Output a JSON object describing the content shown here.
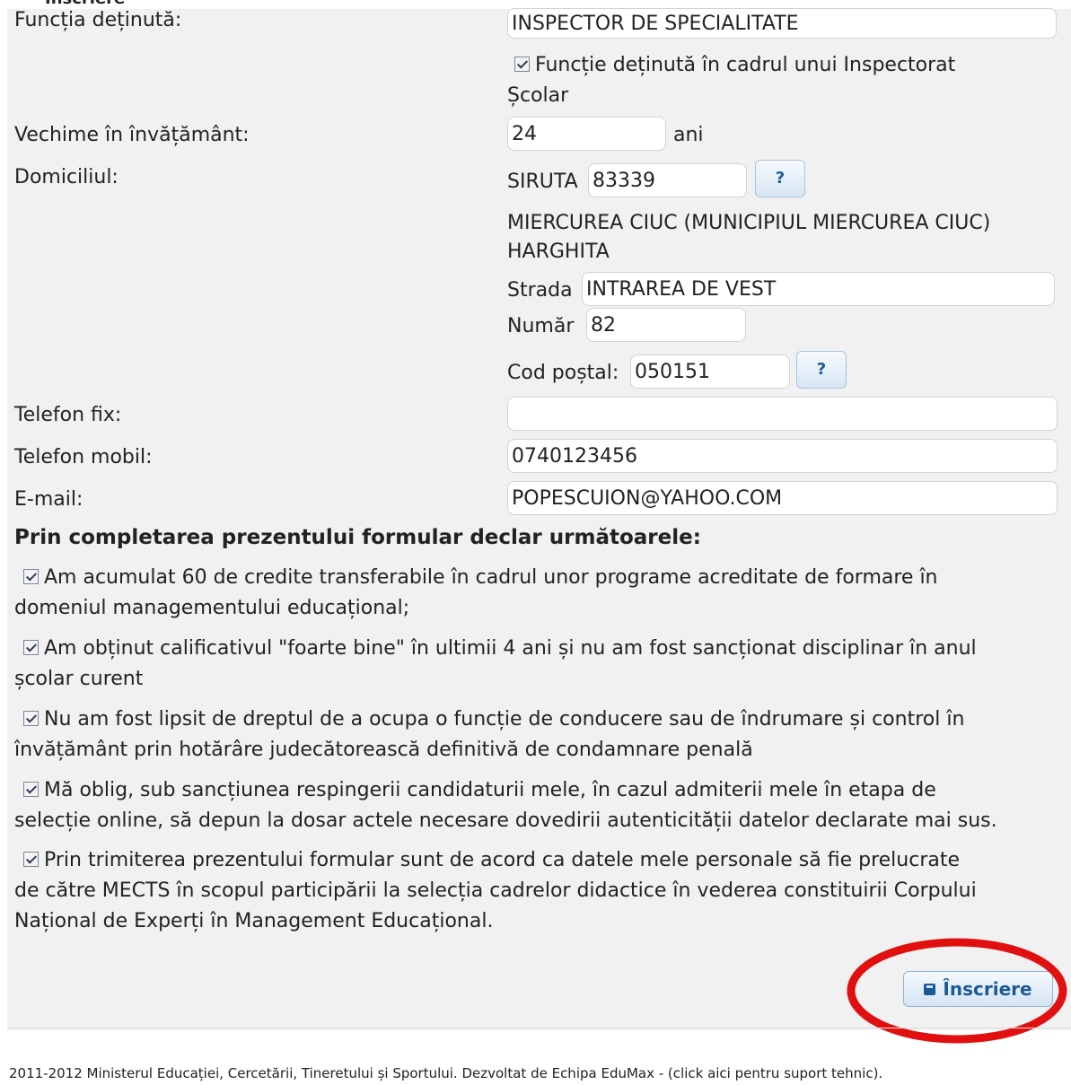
{
  "header": {
    "cut_title": "Înscriere"
  },
  "form": {
    "functia": {
      "label": "Funcția deținută:",
      "value": "INSPECTOR DE SPECIALITATE"
    },
    "inspectorat_checkbox": {
      "line1": "Funcție deținută în cadrul unui Inspectorat",
      "line2": "Școlar"
    },
    "vechime": {
      "label": "Vechime în învățământ:",
      "value": "24",
      "unit": "ani"
    },
    "domiciliu": {
      "label": "Domiciliul:",
      "siruta_label": "SIRUTA",
      "siruta_value": "83339",
      "help_label": "?",
      "locality_line1": "MIERCUREA CIUC (MUNICIPIUL MIERCUREA CIUC)",
      "locality_line2": "HARGHITA",
      "strada_label": "Strada",
      "strada_value": "INTRAREA DE VEST",
      "numar_label": "Număr",
      "numar_value": "82",
      "cod_label": "Cod poștal:",
      "cod_value": "050151"
    },
    "telefon_fix": {
      "label": "Telefon fix:",
      "value": ""
    },
    "telefon_mobil": {
      "label": "Telefon mobil:",
      "value": "0740123456"
    },
    "email": {
      "label": "E-mail:",
      "value": "POPESCUION@YAHOO.COM"
    }
  },
  "declaratii": {
    "title": "Prin completarea prezentului formular declar următoarele:",
    "items": [
      {
        "line1": "Am acumulat 60 de credite transferabile în cadrul unor programe acreditate de formare în",
        "line2": "domeniul managementului educațional;"
      },
      {
        "line1": "Am obținut calificativul \"foarte bine\" în ultimii 4 ani și nu am fost sancționat disciplinar în anul",
        "line2": "școlar curent"
      },
      {
        "line1": "Nu am fost lipsit de dreptul de a ocupa o funcție de conducere sau de îndrumare și control în",
        "line2": "învățământ prin hotărâre judecătorească definitivă de condamnare penală"
      },
      {
        "line1": "Mă oblig, sub sancțiunea respingerii candidaturii mele, în cazul admiterii mele în etapa de",
        "line2": "selecție online, să depun la dosar actele necesare dovedirii autenticității datelor declarate mai sus."
      },
      {
        "line1": "Prin trimiterea prezentului formular sunt de acord ca datele mele personale să fie prelucrate",
        "line2": "de către MECTS în scopul participării la selecția cadrelor didactice în vederea constituirii Corpului",
        "line3": "Național de Experți în Management Educațional."
      }
    ]
  },
  "submit": {
    "label": "Înscriere"
  },
  "annotation": {
    "color": "#e01010"
  },
  "footer": {
    "text": "2011-2012 Ministerul Educației, Cercetării, Tineretului și Sportului. Dezvoltat de Echipa EduMax - (click aici pentru suport tehnic)."
  }
}
